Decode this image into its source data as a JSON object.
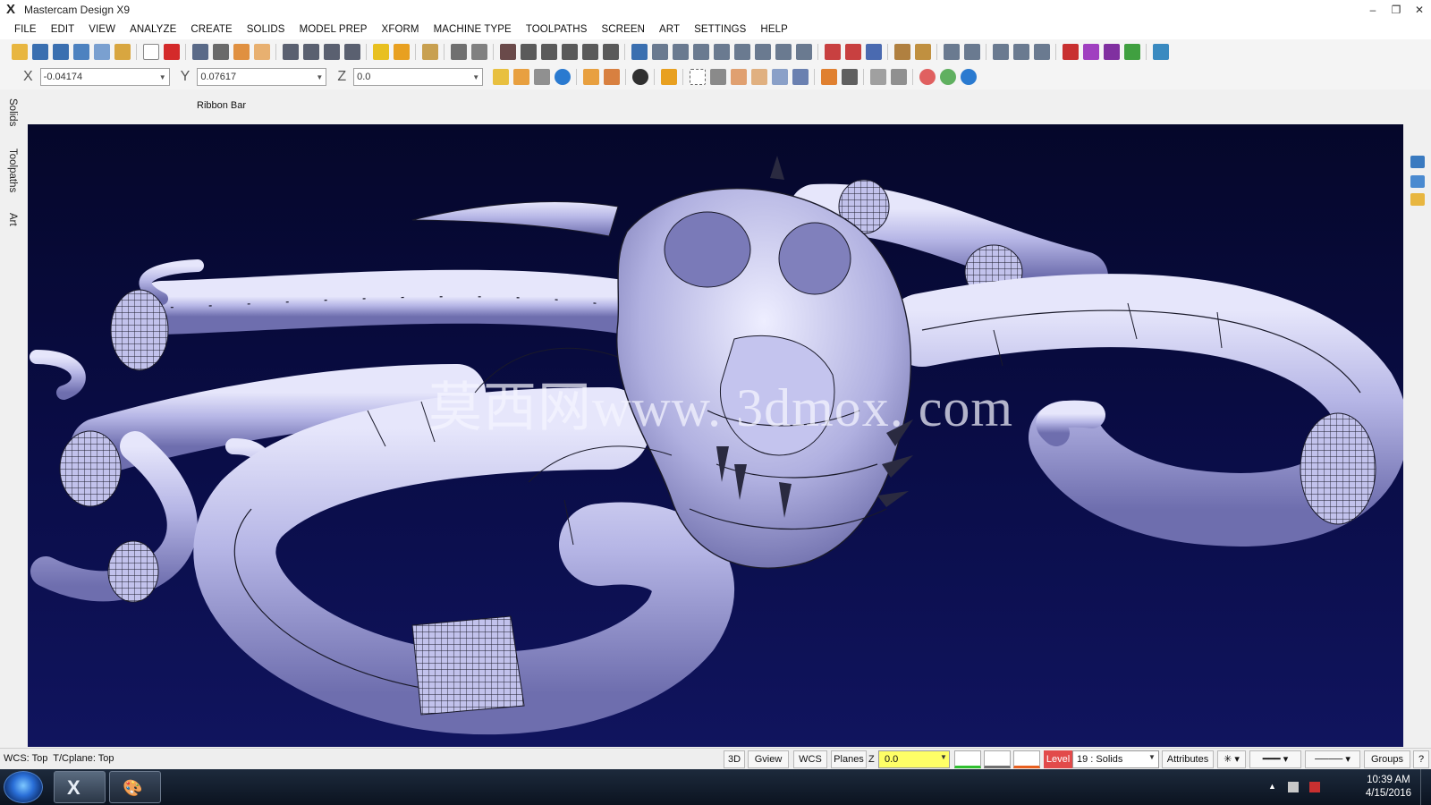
{
  "window": {
    "title": "Mastercam Design X9",
    "logo_glyph": "X",
    "minimize_glyph": "–",
    "restore_glyph": "❐",
    "close_glyph": "✕"
  },
  "menu": {
    "items": [
      "FILE",
      "EDIT",
      "VIEW",
      "ANALYZE",
      "CREATE",
      "SOLIDS",
      "MODEL PREP",
      "XFORM",
      "MACHINE TYPE",
      "TOOLPATHS",
      "SCREEN",
      "ART",
      "SETTINGS",
      "HELP"
    ]
  },
  "coords": {
    "x_label": "X",
    "x_value": "-0.04174",
    "y_label": "Y",
    "y_value": "0.07617",
    "z_label": "Z",
    "z_value": "0.0"
  },
  "ribbon": {
    "label": "Ribbon Bar"
  },
  "left_tabs": [
    "Solids",
    "Toolpaths",
    "Art"
  ],
  "viewport": {
    "watermark": "莫西网www. 3dmox. com",
    "background_color": "#0a0d48",
    "model_color": "#b8b8ea"
  },
  "status": {
    "wcs_text": "WCS: Top",
    "tcplane_text": "T/Cplane: Top",
    "btn_3d": "3D",
    "btn_gview": "Gview",
    "btn_wcs": "WCS",
    "btn_planes": "Planes",
    "z_label": "Z",
    "z_value": "0.0",
    "level_label": "Level",
    "level_value": "19 : Solids",
    "btn_attributes": "Attributes",
    "btn_groups": "Groups",
    "btn_help": "?"
  },
  "taskbar": {
    "time": "10:39 AM",
    "date": "4/15/2016",
    "app_glyph": "X"
  }
}
